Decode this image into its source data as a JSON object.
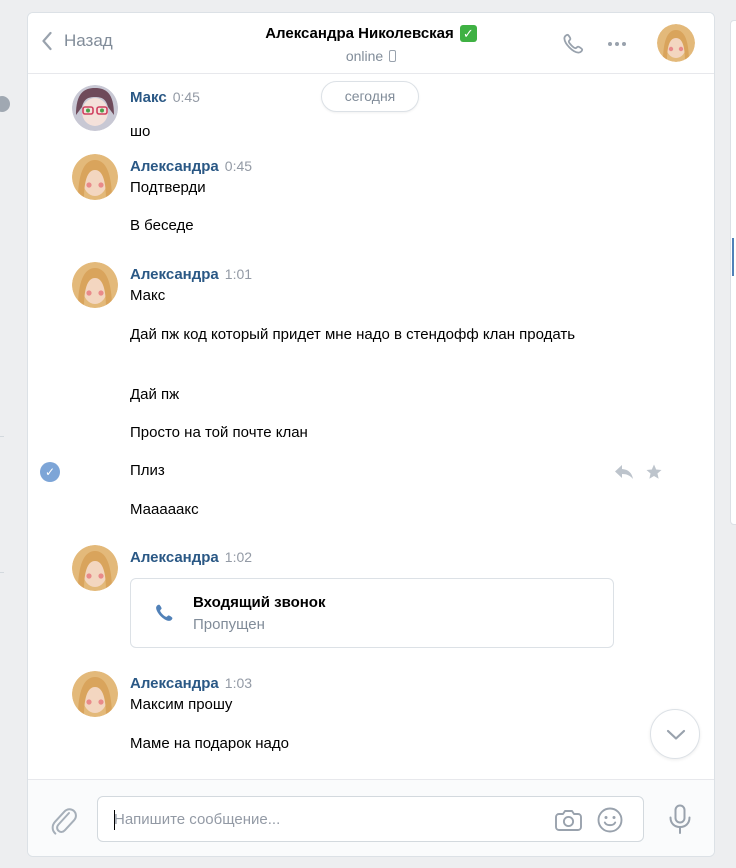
{
  "header": {
    "back_label": "Назад",
    "contact_name": "Александра Николевская",
    "verified_mark": "✓",
    "status": "online"
  },
  "chat": {
    "date_divider": "сегодня",
    "groups": [
      {
        "author": "Макс",
        "time": "0:45",
        "messages": [
          "шо"
        ]
      },
      {
        "author": "Александра",
        "time": "0:45",
        "messages": [
          "Подтверди",
          "В беседе"
        ]
      },
      {
        "author": "Александра",
        "time": "1:01",
        "messages": [
          "Макс",
          "Дай пж код который придет мне надо в стендофф клан продать",
          "Дай пж",
          "Просто на той почте клан",
          "Плиз",
          "Мааааакс"
        ]
      },
      {
        "author": "Александра",
        "time": "1:02",
        "call": {
          "title": "Входящий звонок",
          "subtitle": "Пропущен"
        }
      },
      {
        "author": "Александра",
        "time": "1:03",
        "messages": [
          "Максим прошу",
          "Маме на подарок надо"
        ]
      }
    ],
    "selected_mark": "✓"
  },
  "composer": {
    "placeholder": "Напишите сообщение..."
  },
  "colors": {
    "accent": "#5181b8",
    "author": "#2a5885",
    "verified": "#3fb143",
    "muted": "#818c99"
  }
}
